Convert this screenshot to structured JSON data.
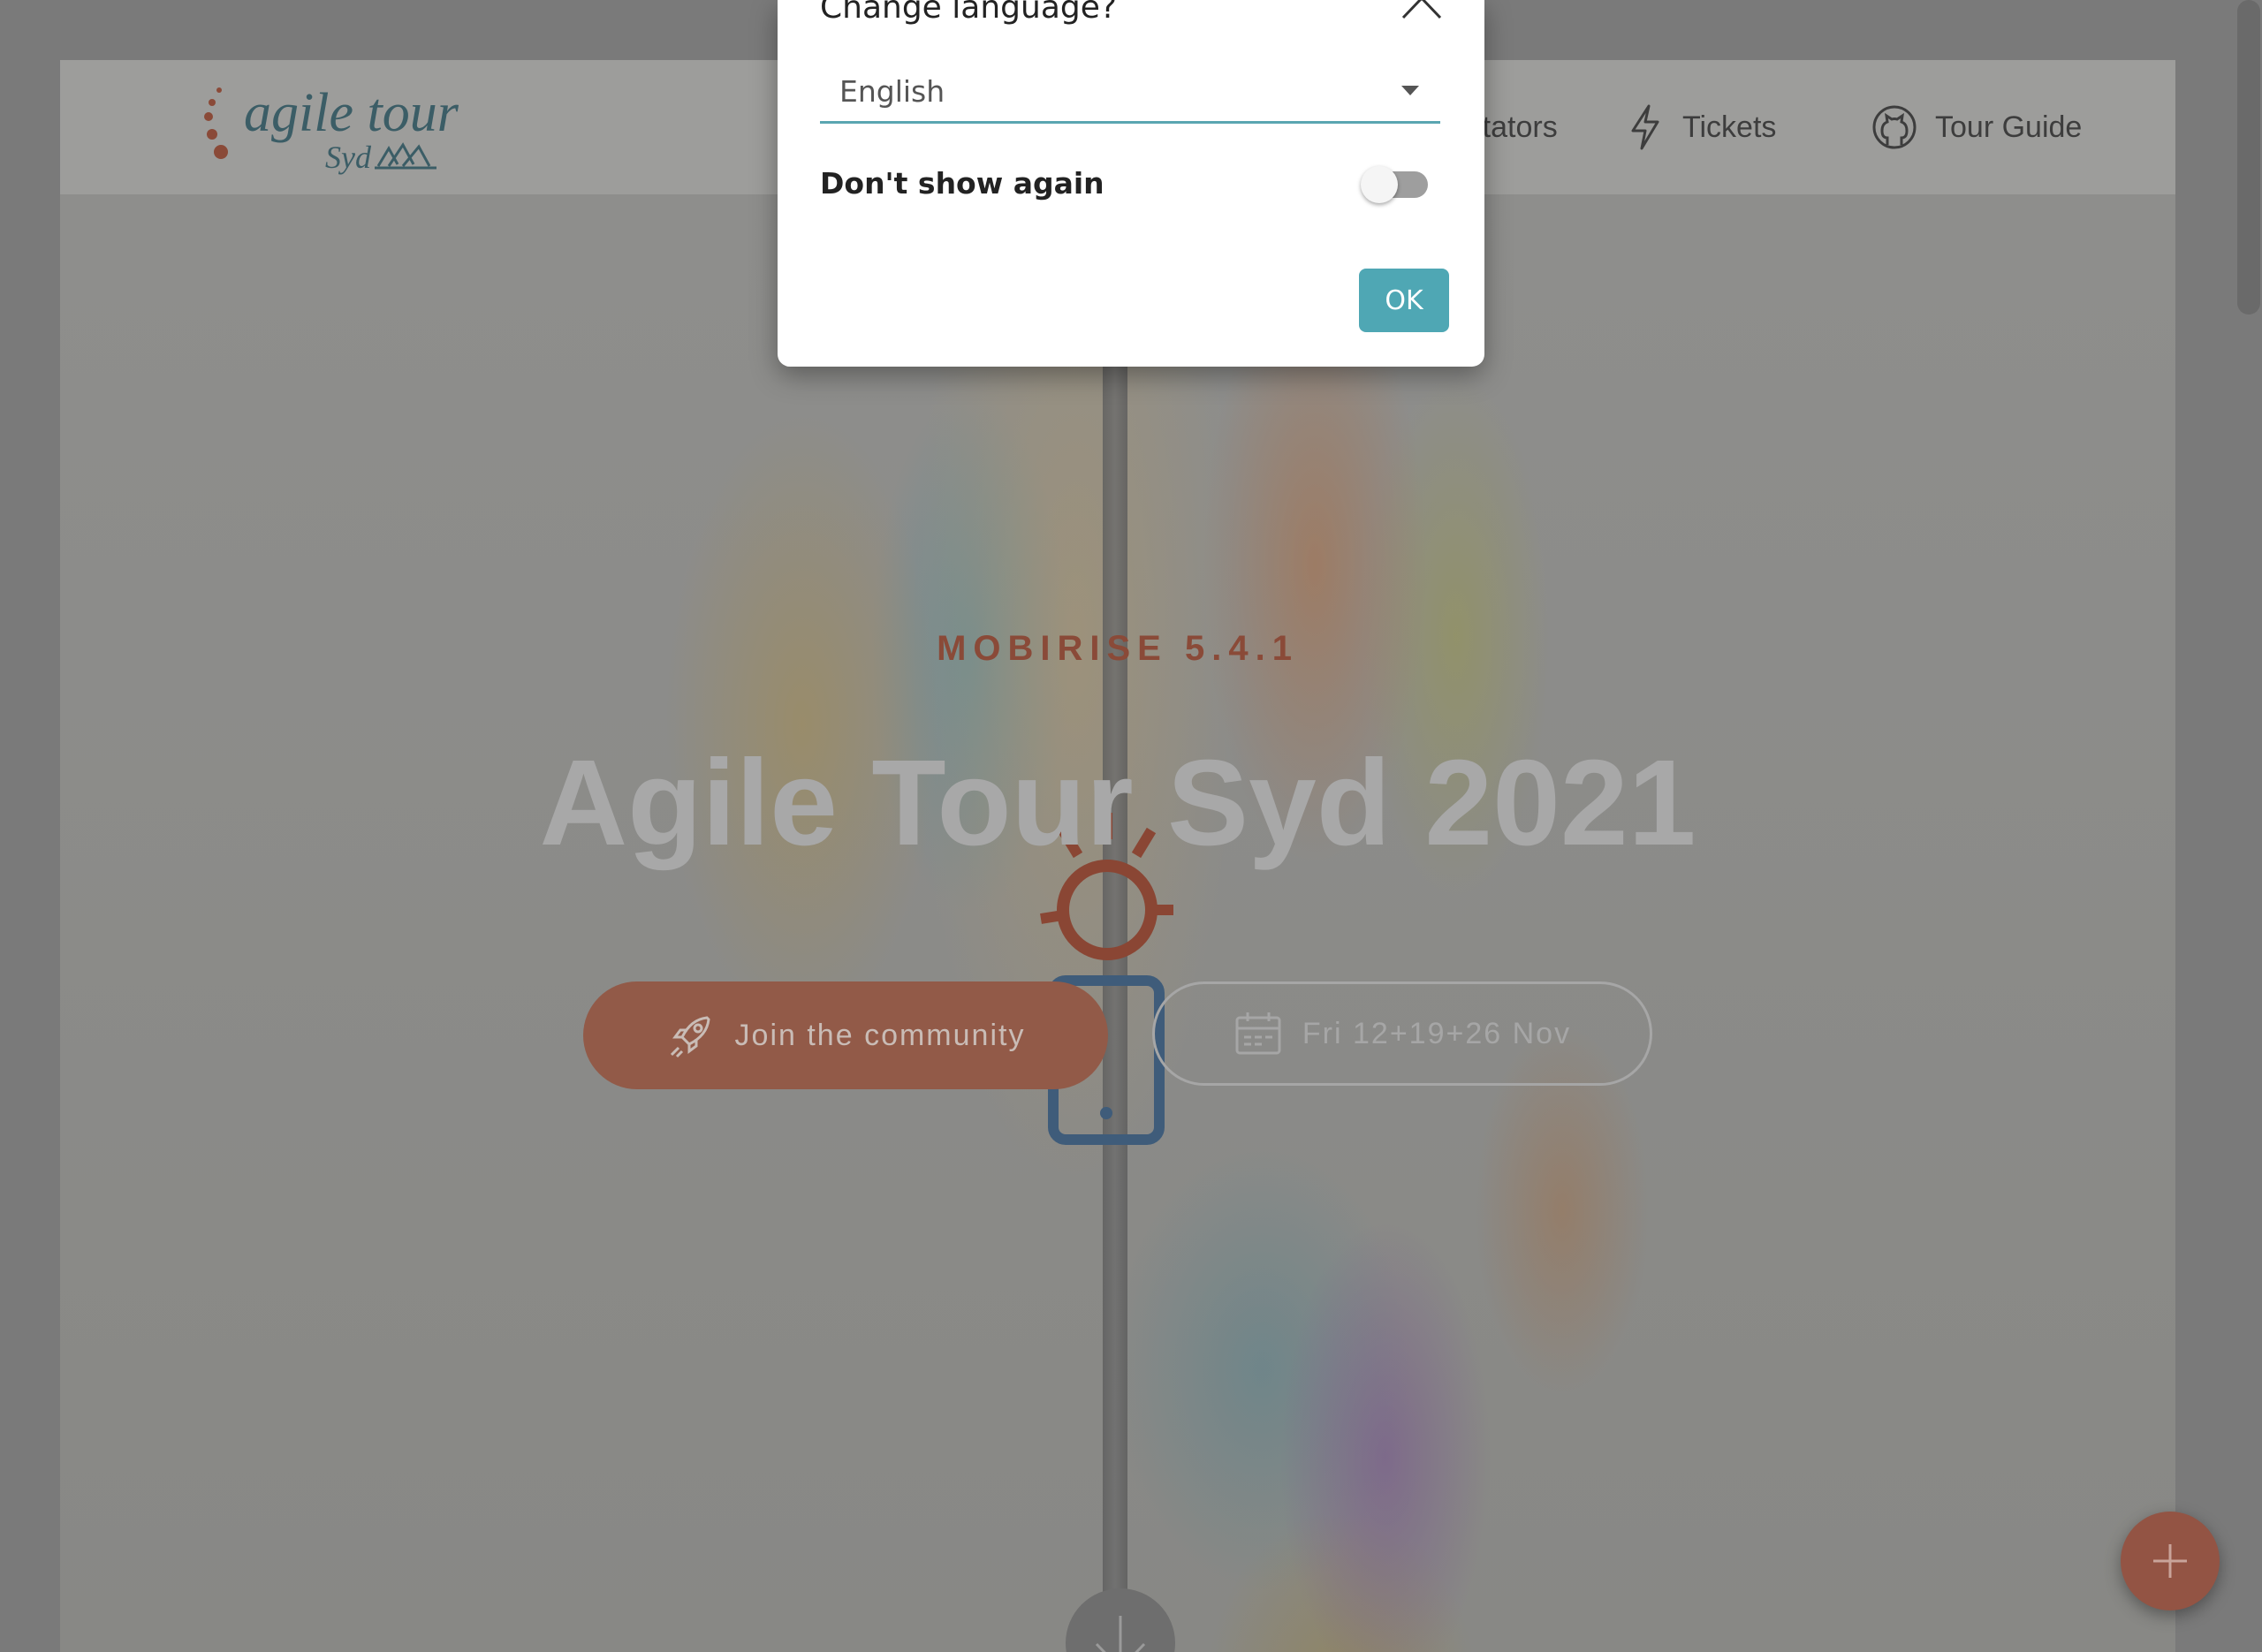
{
  "nav": {
    "logo_text": "agile tour",
    "logo_subtext": "Syd",
    "items": [
      {
        "label": "cilitators"
      },
      {
        "label": "Tickets",
        "icon": "lightning-icon"
      },
      {
        "label": "Tour Guide",
        "icon": "github-icon"
      }
    ]
  },
  "hero": {
    "kicker": "MOBIRISE  5.4.1",
    "title": "Agile Tour Syd 2021",
    "primary_button": "Join the community",
    "secondary_button": "Fri 12+19+26 Nov"
  },
  "modal": {
    "title": "Change language?",
    "select_value": "English",
    "toggle_label": "Don't show again",
    "toggle_on": false,
    "ok_label": "OK"
  },
  "colors": {
    "accent_teal": "#4fa7b4",
    "accent_coral": "#935444",
    "overlay": "#7a7a7a"
  }
}
